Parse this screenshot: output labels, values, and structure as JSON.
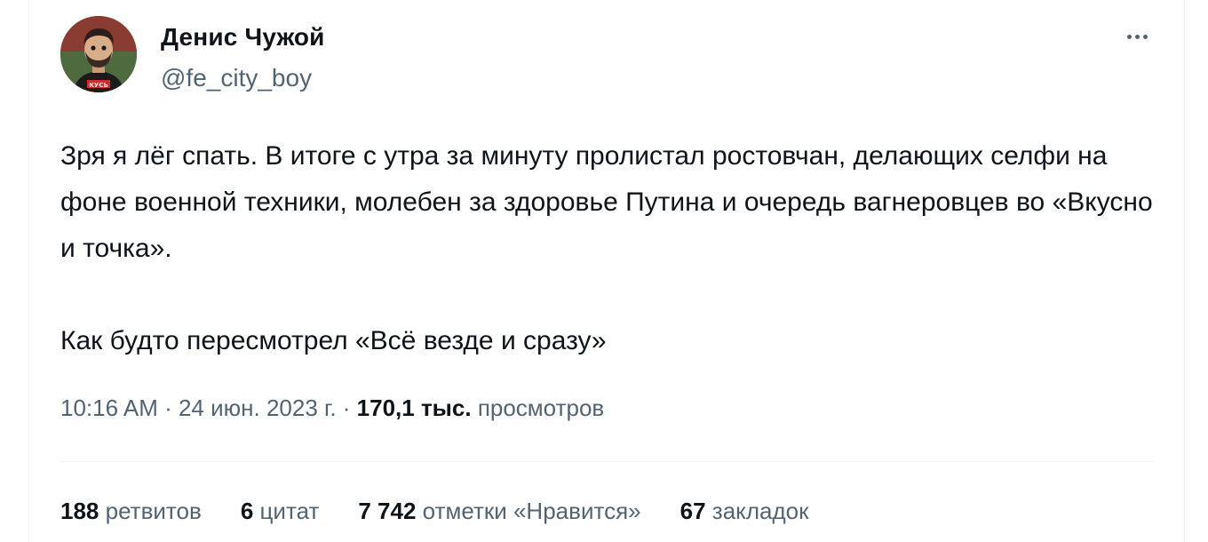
{
  "author": {
    "display_name": "Денис Чужой",
    "handle": "@fe_city_boy",
    "avatar_shirt_text": "КУСЬ"
  },
  "more_icon": "more-horizontal-icon",
  "tweet": {
    "paragraph_1": "Зря я лёг спать. В итоге с утра за минуту пролистал ростовчан, делающих селфи на фоне военной техники, молебен за здоровье Путина и очередь вагнеровцев во «Вкусно и точка».",
    "paragraph_2": "Как будто пересмотрел «Всё везде и сразу»"
  },
  "meta": {
    "time": "10:16 AM",
    "separator": " · ",
    "date": "24 июн. 2023 г.",
    "views_count": "170,1 тыс.",
    "views_label": "просмотров"
  },
  "stats": {
    "retweets_count": "188",
    "retweets_label": "ретвитов",
    "quotes_count": "6",
    "quotes_label": "цитат",
    "likes_count": "7 742",
    "likes_label": "отметки «Нравится»",
    "bookmarks_count": "67",
    "bookmarks_label": "закладок"
  },
  "colors": {
    "text_primary": "#0f1419",
    "text_secondary": "#536471",
    "divider": "#eff3f4"
  }
}
